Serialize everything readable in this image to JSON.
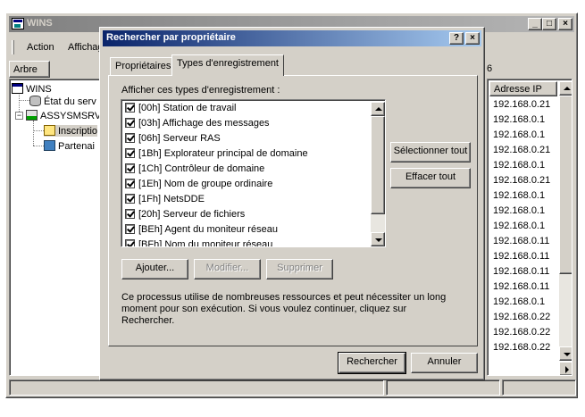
{
  "wins_window": {
    "title": "WINS",
    "menu": {
      "action": "Action",
      "affichage": "Affichage"
    },
    "pane_header": "Arbre",
    "right_label": "6",
    "tree": {
      "root": "WINS",
      "items": [
        {
          "label": "État du serv"
        },
        {
          "label": "ASSYSMSRV"
        },
        {
          "label": "Inscriptio"
        },
        {
          "label": "Partenai"
        }
      ]
    },
    "ip_list": {
      "header": "Adresse IP",
      "rows": [
        "192.168.0.21",
        "192.168.0.1",
        "192.168.0.1",
        "192.168.0.21",
        "192.168.0.1",
        "192.168.0.21",
        "192.168.0.1",
        "192.168.0.1",
        "192.168.0.1",
        "192.168.0.11",
        "192.168.0.11",
        "192.168.0.11",
        "192.168.0.11",
        "192.168.0.1",
        "192.168.0.22",
        "192.168.0.22",
        "192.168.0.22"
      ]
    },
    "caption_buttons": {
      "minimize": "_",
      "maximize": "□",
      "close": "×"
    }
  },
  "dialog": {
    "title": "Rechercher par propriétaire",
    "caption_buttons": {
      "help": "?",
      "close": "×"
    },
    "tabs": [
      {
        "label": "Propriétaires",
        "active": false
      },
      {
        "label": "Types d'enregistrement",
        "active": true
      }
    ],
    "types_label": "Afficher ces types d'enregistrement :",
    "record_types": [
      {
        "label": "[00h] Station de travail",
        "checked": true
      },
      {
        "label": "[03h] Affichage des messages",
        "checked": true
      },
      {
        "label": "[06h] Serveur RAS",
        "checked": true
      },
      {
        "label": "[1Bh] Explorateur principal de domaine",
        "checked": true
      },
      {
        "label": "[1Ch] Contrôleur de domaine",
        "checked": true
      },
      {
        "label": "[1Eh] Nom de groupe ordinaire",
        "checked": true
      },
      {
        "label": "[1Fh] NetsDDE",
        "checked": true
      },
      {
        "label": "[20h] Serveur de fichiers",
        "checked": true
      },
      {
        "label": "[BEh] Agent du moniteur réseau",
        "checked": true
      },
      {
        "label": "[BFh] Nom du moniteur réseau",
        "checked": true
      }
    ],
    "buttons": {
      "select_all": "Sélectionner tout",
      "clear_all": "Effacer tout",
      "add": "Ajouter...",
      "modify": "Modifier...",
      "delete": "Supprimer",
      "search": "Rechercher",
      "cancel": "Annuler"
    },
    "info_text": "Ce processus utilise de nombreuses ressources et peut nécessiter un long moment pour son exécution. Si vous voulez continuer, cliquez sur Rechercher."
  }
}
